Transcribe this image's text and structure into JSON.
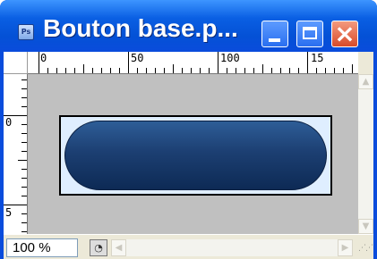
{
  "window": {
    "title": "Bouton base.p...",
    "app_icon_label": "Ps",
    "title_bar_color": "#0a5fe3"
  },
  "ruler": {
    "h_labels": [
      "0",
      "50",
      "100",
      "15"
    ],
    "v_labels": [
      "0",
      "5"
    ]
  },
  "status": {
    "zoom": "100 %"
  },
  "icons": {
    "app": "photoshop-icon",
    "minimize": "minimize-icon",
    "maximize": "maximize-icon",
    "close": "close-icon",
    "info": "document-info-icon",
    "grip": "resize-grip-icon"
  },
  "colors": {
    "canvas_bg": "#c0c0c0",
    "doc_bg": "#dfeeff",
    "button_fill": "#1c3f72"
  }
}
